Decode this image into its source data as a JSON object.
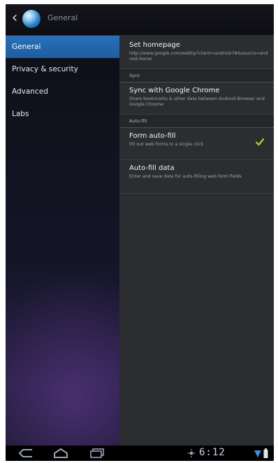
{
  "action_bar": {
    "title": "General",
    "icons": {
      "back": "chevron-left-icon",
      "app": "browser-globe-icon"
    }
  },
  "sidebar": {
    "items": [
      {
        "label": "General",
        "selected": true
      },
      {
        "label": "Privacy & security",
        "selected": false
      },
      {
        "label": "Advanced",
        "selected": false
      },
      {
        "label": "Labs",
        "selected": false
      }
    ]
  },
  "settings": {
    "homepage": {
      "title": "Set homepage",
      "summary": "http://www.google.com/webhp?client=android-f#&source=android-home"
    },
    "sync_header": "Sync",
    "sync": {
      "title": "Sync with Google Chrome",
      "summary": "Share bookmarks & other data between Android Browser and Google Chrome"
    },
    "autofill_header": "Auto-fill",
    "form_autofill": {
      "title": "Form auto-fill",
      "summary": "Fill out web forms in a single click",
      "checked": true
    },
    "autofill_data": {
      "title": "Auto-fill data",
      "summary": "Enter and save data for auto-filling web form fields"
    }
  },
  "status_bar": {
    "time": "6:12",
    "icons": [
      "back-icon",
      "home-icon",
      "recent-apps-icon",
      "notification-icon",
      "wifi-icon",
      "battery-icon"
    ]
  },
  "colors": {
    "selected_accent": "#2a71b9",
    "check_accent": "#b5d429",
    "pane_bg": "#2b2d31"
  }
}
